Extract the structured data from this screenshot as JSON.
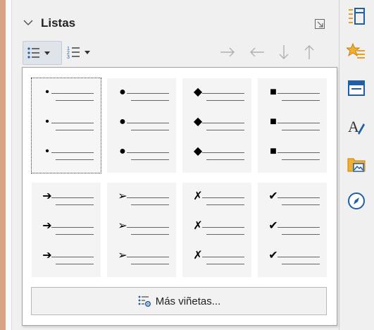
{
  "deck": {
    "title": "Listas"
  },
  "toolbar": {
    "unordered_list": "unordered-list-icon",
    "ordered_list": "ordered-list-icon",
    "nav": [
      "→",
      "←",
      "↓",
      "↑"
    ]
  },
  "popup": {
    "rows": [
      [
        "•",
        "●",
        "◆",
        "■"
      ],
      [
        "➔",
        "➢",
        "✗",
        "✔"
      ]
    ],
    "more_button_label": "Más viñetas..."
  },
  "sidebar": {
    "icons": [
      "properties-icon",
      "styles-icon",
      "page-icon",
      "character-icon",
      "gallery-icon",
      "navigator-icon"
    ]
  },
  "colors": {
    "accent_orange": "#e8a020",
    "icon_blue": "#1e5fa8"
  }
}
